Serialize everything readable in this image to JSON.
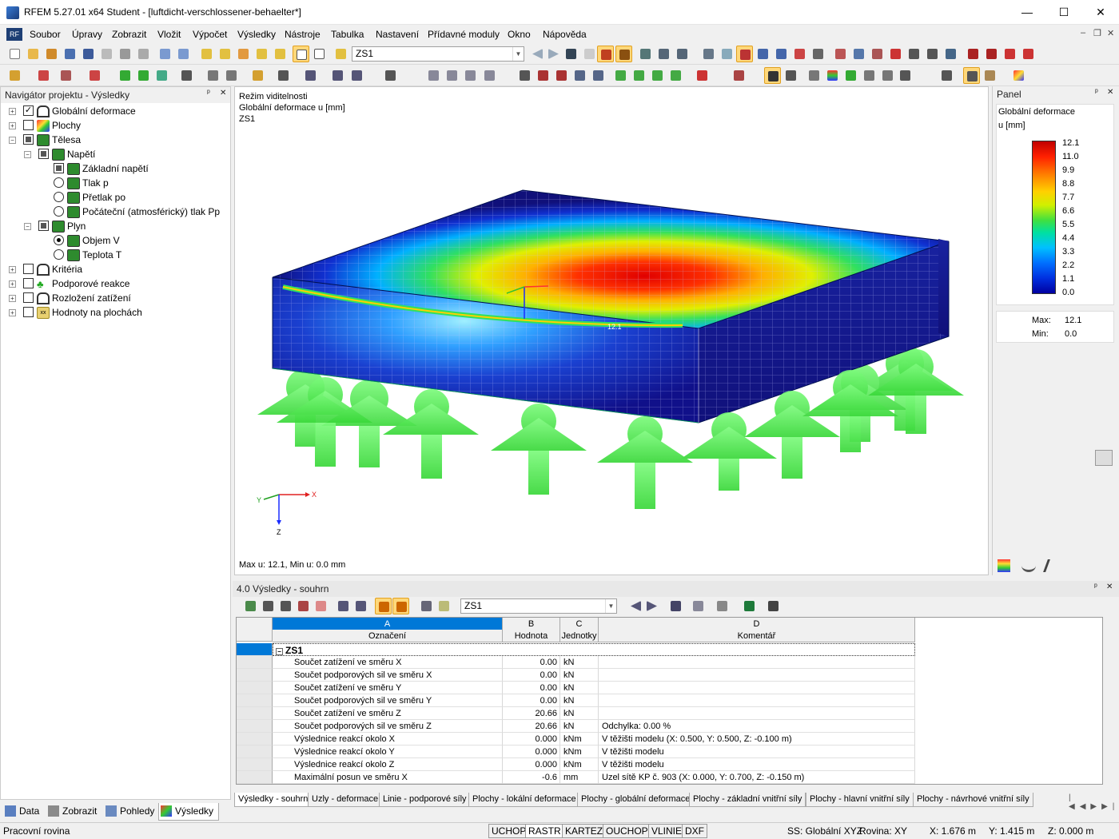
{
  "window": {
    "title": "RFEM 5.27.01 x64 Student - [luftdicht-verschlossener-behaelter*]",
    "min": "—",
    "max": "☐",
    "close": "✕"
  },
  "menu": [
    "Soubor",
    "Úpravy",
    "Zobrazit",
    "Vložit",
    "Výpočet",
    "Výsledky",
    "Nástroje",
    "Tabulka",
    "Nastavení",
    "Přídavné moduly",
    "Okno",
    "Nápověda"
  ],
  "mdi_controls": [
    "–",
    "❐",
    "✕"
  ],
  "toolbar": {
    "load_case": "ZS1"
  },
  "navigator": {
    "title": "Navigátor projektu - Výsledky",
    "pin": "ᵖ",
    "close": "✕",
    "items": [
      {
        "label": "Globální deformace"
      },
      {
        "label": "Plochy"
      },
      {
        "label": "Tělesa"
      },
      {
        "label": "Napětí"
      },
      {
        "label": "Základní napětí"
      },
      {
        "label": "Tlak p"
      },
      {
        "label": "Přetlak po"
      },
      {
        "label": "Počáteční (atmosférický) tlak Pp"
      },
      {
        "label": "Plyn"
      },
      {
        "label": "Objem V"
      },
      {
        "label": "Teplota T"
      },
      {
        "label": "Kritéria"
      },
      {
        "label": "Podporové reakce"
      },
      {
        "label": "Rozložení zatížení"
      },
      {
        "label": "Hodnoty na plochách"
      }
    ],
    "tabs": [
      "Data",
      "Zobrazit",
      "Pohledy",
      "Výsledky"
    ]
  },
  "viewport": {
    "line1": "Režim viditelnosti",
    "line2": "Globální deformace u [mm]",
    "line3": "ZS1",
    "footer": "Max u: 12.1, Min u: 0.0 mm",
    "axis_x": "X",
    "axis_y": "Y",
    "axis_z": "Z",
    "peak_label": "12.1"
  },
  "panel": {
    "title": "Panel",
    "heading": "Globální deformace",
    "unit": "u [mm]",
    "legend_values": [
      "12.1",
      "11.0",
      "9.9",
      "8.8",
      "7.7",
      "6.6",
      "5.5",
      "4.4",
      "3.3",
      "2.2",
      "1.1",
      "0.0"
    ],
    "max_label": "Max:",
    "max_value": "12.1",
    "min_label": "Min:",
    "min_value": "0.0"
  },
  "results": {
    "title": "4.0 Výsledky - souhrn",
    "load_case": "ZS1",
    "col_letters": [
      "A",
      "B",
      "C",
      "D"
    ],
    "col_headers": [
      "Označení",
      "Hodnota",
      "Jednotky",
      "Komentář"
    ],
    "group": "ZS1",
    "rows": [
      {
        "label": "Součet zatížení ve směru X",
        "value": "0.00",
        "unit": "kN",
        "comment": ""
      },
      {
        "label": "Součet podporových sil ve směru X",
        "value": "0.00",
        "unit": "kN",
        "comment": ""
      },
      {
        "label": "Součet zatížení ve směru Y",
        "value": "0.00",
        "unit": "kN",
        "comment": ""
      },
      {
        "label": "Součet podporových sil ve směru Y",
        "value": "0.00",
        "unit": "kN",
        "comment": ""
      },
      {
        "label": "Součet zatížení ve směru Z",
        "value": "20.66",
        "unit": "kN",
        "comment": ""
      },
      {
        "label": "Součet podporových sil ve směru Z",
        "value": "20.66",
        "unit": "kN",
        "comment": "Odchylka:  0.00 %"
      },
      {
        "label": "Výslednice reakcí okolo X",
        "value": "0.000",
        "unit": "kNm",
        "comment": "V těžišti modelu (X: 0.500, Y: 0.500, Z: -0.100 m)"
      },
      {
        "label": "Výslednice reakcí okolo Y",
        "value": "0.000",
        "unit": "kNm",
        "comment": "V těžišti modelu"
      },
      {
        "label": "Výslednice reakcí okolo Z",
        "value": "0.000",
        "unit": "kNm",
        "comment": "V těžišti modelu"
      },
      {
        "label": "Maximální posun ve směru X",
        "value": "-0.6",
        "unit": "mm",
        "comment": "Uzel sítě KP č. 903  (X: 0.000,  Y: 0.700,  Z: -0.150 m)"
      }
    ],
    "tabs": [
      "Výsledky - souhrn",
      "Uzly - deformace",
      "Linie - podporové síly",
      "Plochy - lokální deformace",
      "Plochy - globální deformace",
      "Plochy - základní vnitřní síly",
      "Plochy - hlavní vnitřní síly",
      "Plochy - návrhové vnitřní síly"
    ]
  },
  "status": {
    "left": "Pracovní rovina",
    "buttons": [
      "UCHOP",
      "RASTR",
      "KARTEZ",
      "OUCHOP",
      "VLINIE",
      "DXF"
    ],
    "ss": "SS: Globální XYZ",
    "plane": "Rovina: XY",
    "x": "X:  1.676 m",
    "y": "Y:  1.415 m",
    "z": "Z:  0.000 m"
  }
}
